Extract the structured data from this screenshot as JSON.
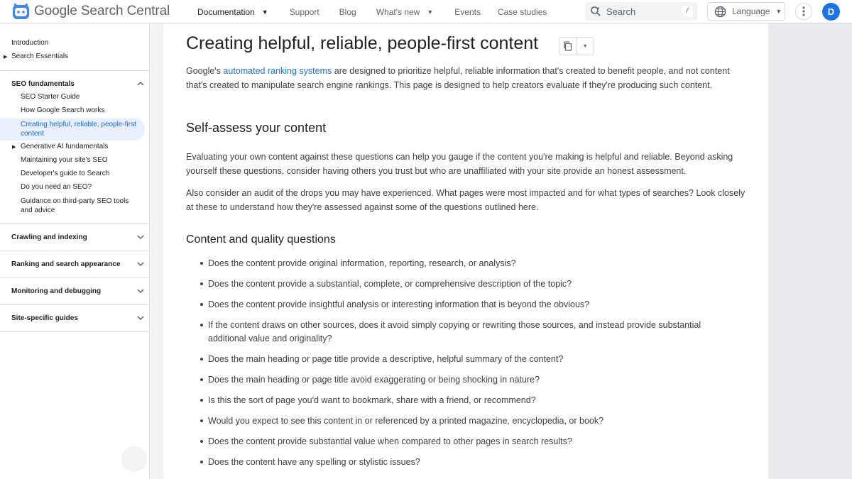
{
  "header": {
    "brand": "Google Search Central",
    "nav": [
      {
        "label": "Documentation",
        "active": true,
        "has_menu": true
      },
      {
        "label": "Support",
        "active": false,
        "has_menu": false
      },
      {
        "label": "Blog",
        "active": false,
        "has_menu": false
      },
      {
        "label": "What's new",
        "active": false,
        "has_menu": true
      },
      {
        "label": "Events",
        "active": false,
        "has_menu": false
      },
      {
        "label": "Case studies",
        "active": false,
        "has_menu": false
      }
    ],
    "search_placeholder": "Search",
    "search_shortcut": "/",
    "language_label": "Language",
    "avatar_initial": "D",
    "accent_color": "#1a73e8"
  },
  "sidebar": {
    "top_links": [
      {
        "label": "Introduction",
        "expandable": false
      },
      {
        "label": "Search Essentials",
        "expandable": true
      }
    ],
    "seo_section": {
      "title": "SEO fundamentals",
      "expanded": true,
      "items": [
        {
          "label": "SEO Starter Guide"
        },
        {
          "label": "How Google Search works"
        },
        {
          "label": "Creating helpful, reliable, people-first content",
          "active": true
        },
        {
          "label": "Generative AI fundamentals",
          "expandable": true
        },
        {
          "label": "Maintaining your site's SEO"
        },
        {
          "label": "Developer's guide to Search"
        },
        {
          "label": "Do you need an SEO?"
        },
        {
          "label": "Guidance on third-party SEO tools and advice"
        }
      ]
    },
    "collapsed_sections": [
      {
        "title": "Crawling and indexing"
      },
      {
        "title": "Ranking and search appearance"
      },
      {
        "title": "Monitoring and debugging"
      },
      {
        "title": "Site-specific guides"
      }
    ]
  },
  "article": {
    "title": "Creating helpful, reliable, people-first content",
    "intro_before_link": "Google's ",
    "intro_link": "automated ranking systems",
    "intro_after_link": " are designed to prioritize helpful, reliable information that's created to benefit people, and not content that's created to manipulate search engine rankings. This page is designed to help creators evaluate if they're producing such content.",
    "section_heading": "Self-assess your content",
    "para1": "Evaluating your own content against these questions can help you gauge if the content you're making is helpful and reliable. Beyond asking yourself these questions, consider having others you trust but who are unaffiliated with your site provide an honest assessment.",
    "para2": "Also consider an audit of the drops you may have experienced. What pages were most impacted and for what types of searches? Look closely at these to understand how they're assessed against some of the questions outlined here.",
    "subheading": "Content and quality questions",
    "questions": [
      "Does the content provide original information, reporting, research, or analysis?",
      "Does the content provide a substantial, complete, or comprehensive description of the topic?",
      "Does the content provide insightful analysis or interesting information that is beyond the obvious?",
      "If the content draws on other sources, does it avoid simply copying or rewriting those sources, and instead provide substantial additional value and originality?",
      "Does the main heading or page title provide a descriptive, helpful summary of the content?",
      "Does the main heading or page title avoid exaggerating or being shocking in nature?",
      "Is this the sort of page you'd want to bookmark, share with a friend, or recommend?",
      "Would you expect to see this content in or referenced by a printed magazine, encyclopedia, or book?",
      "Does the content provide substantial value when compared to other pages in search results?",
      "Does the content have any spelling or stylistic issues?"
    ]
  }
}
